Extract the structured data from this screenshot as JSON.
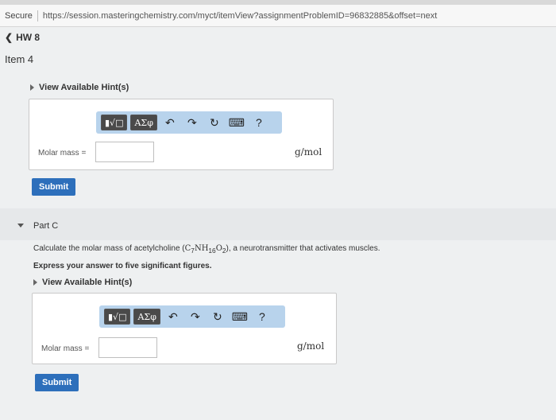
{
  "browser": {
    "secure_label": "Secure",
    "url": "https://session.masteringchemistry.com/myct/itemView?assignmentProblemID=96832885&offset=next"
  },
  "nav": {
    "back_label": "HW 8"
  },
  "item": {
    "title": "Item 4"
  },
  "part_b": {
    "hint_label": "View Available Hint(s)",
    "field_label": "Molar mass =",
    "unit": "g/mol",
    "submit_label": "Submit",
    "toolbar": {
      "templates_label": "▮√□",
      "greek_label": "ΑΣφ",
      "help_label": "?"
    }
  },
  "part_c": {
    "title": "Part C",
    "question_pre": "Calculate the molar mass of acetylcholine (",
    "formula": {
      "c": "C",
      "c_sub": "7",
      "nh": "NH",
      "h_sub": "16",
      "o": "O",
      "o_sub": "2"
    },
    "question_post": "), a neurotransmitter that activates muscles.",
    "instruction": "Express your answer to five significant figures.",
    "hint_label": "View Available Hint(s)",
    "field_label": "Molar mass =",
    "unit": "g/mol",
    "submit_label": "Submit",
    "toolbar": {
      "templates_label": "▮√□",
      "greek_label": "ΑΣφ",
      "help_label": "?"
    }
  },
  "colors": {
    "accent": "#2d6fbb",
    "toolbar_bg": "#b8d3ec"
  }
}
